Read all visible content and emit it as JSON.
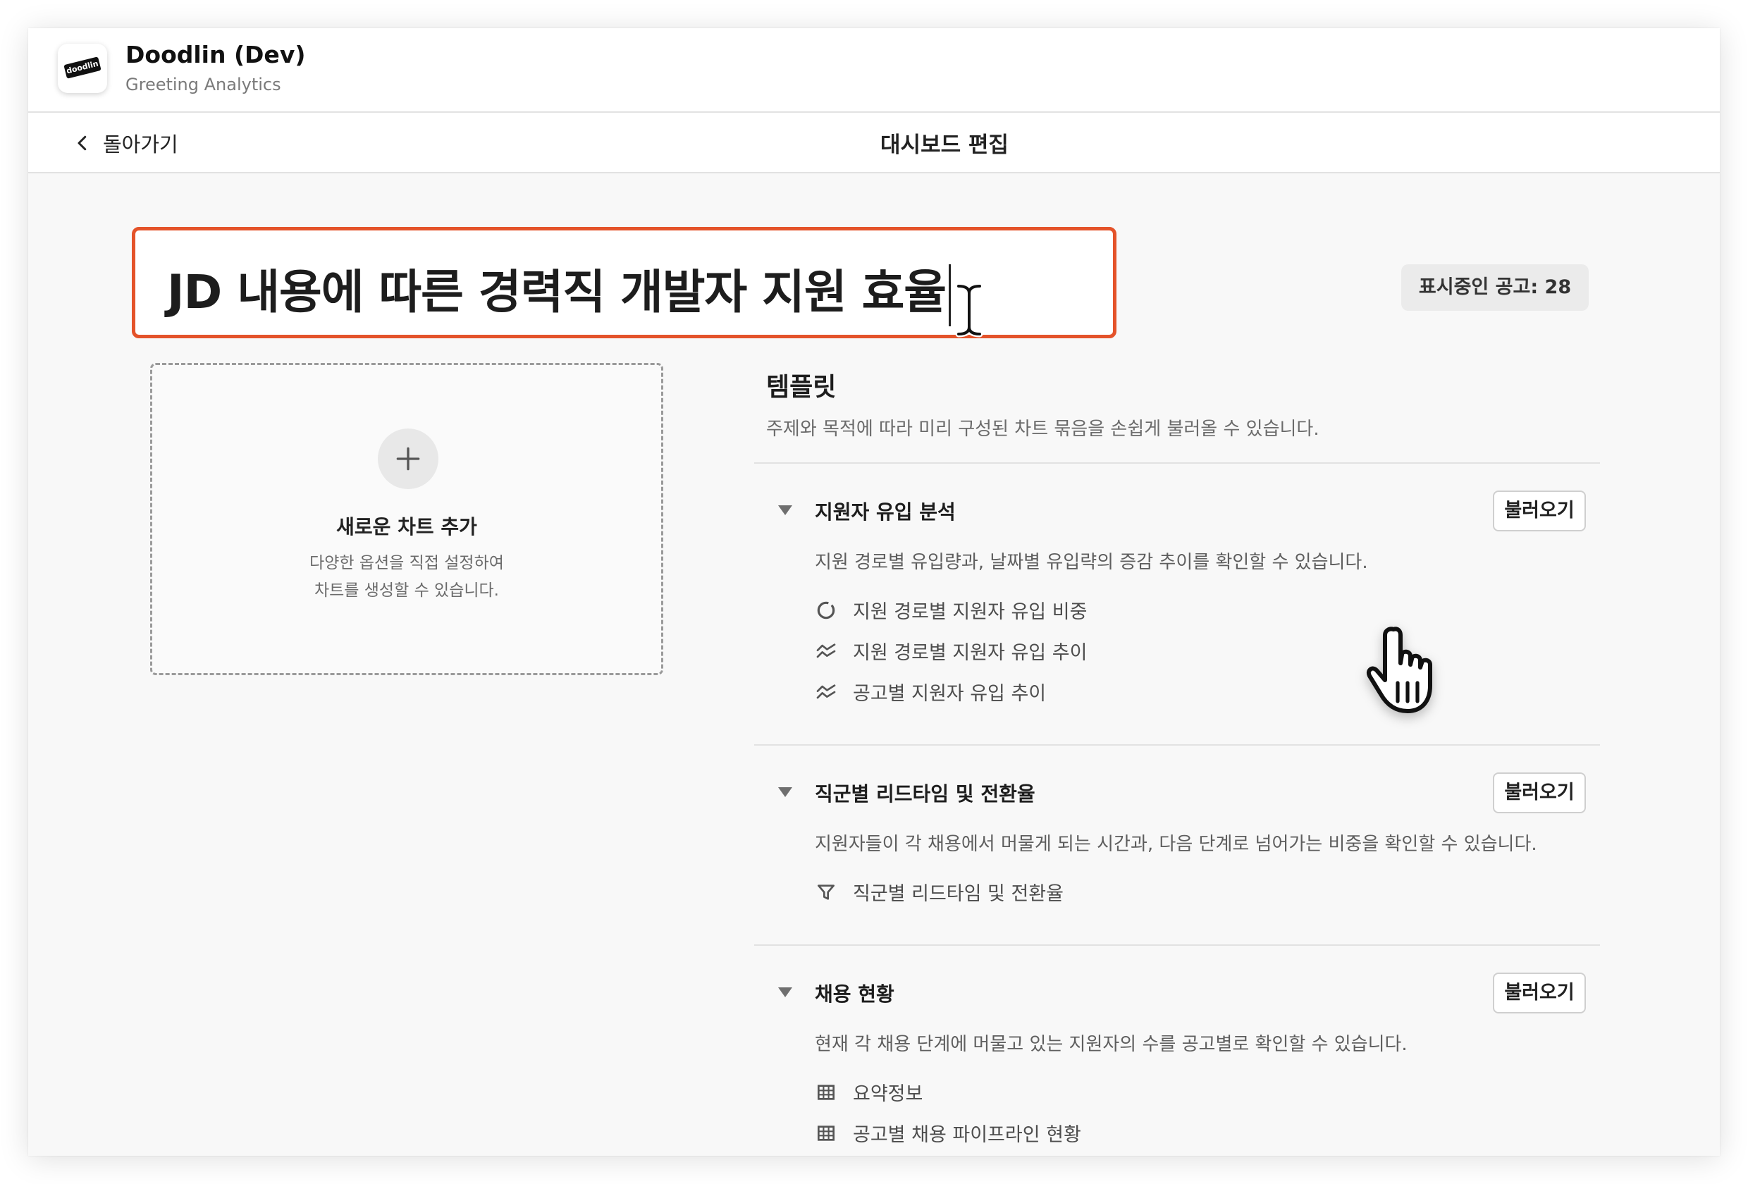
{
  "app": {
    "name": "Doodlin (Dev)",
    "subtitle": "Greeting Analytics",
    "logo_text": "doodlin"
  },
  "nav": {
    "back_label": "돌아가기",
    "page_title": "대시보드 편집"
  },
  "dashboard": {
    "title_value": "JD 내용에 따른 경력직 개발자 지원 효율",
    "badge_label": "표시중인 공고: 28"
  },
  "add_chart": {
    "title": "새로운 차트 추가",
    "desc_line1": "다양한 옵션을 직접 설정하여",
    "desc_line2": "차트를 생성할 수 있습니다."
  },
  "templates": {
    "heading": "템플릿",
    "description": "주제와 목적에 따라 미리 구성된 차트 묶음을 손쉽게 불러올 수 있습니다.",
    "load_label": "불러오기",
    "sections": [
      {
        "title": "지원자 유입 분석",
        "description": "지원 경로별 유입량과, 날짜별 유입략의 증감 추이를 확인할 수 있습니다.",
        "charts": [
          {
            "label": "지원 경로별 지원자 유입 비중",
            "icon": "donut-icon"
          },
          {
            "label": "지원 경로별 지원자 유입 추이",
            "icon": "line-chart-icon"
          },
          {
            "label": "공고별 지원자 유입 추이",
            "icon": "line-chart-icon"
          }
        ]
      },
      {
        "title": "직군별 리드타임 및 전환율",
        "description": "지원자들이 각 채용에서 머물게 되는 시간과, 다음 단계로 넘어가는 비중을 확인할 수 있습니다.",
        "charts": [
          {
            "label": "직군별 리드타임 및 전환율",
            "icon": "funnel-icon"
          }
        ]
      },
      {
        "title": "채용 현황",
        "description": "현재 각 채용 단계에 머물고 있는 지원자의 수를 공고별로 확인할 수 있습니다.",
        "charts": [
          {
            "label": "요약정보",
            "icon": "table-icon"
          },
          {
            "label": "공고별 채용 파이프라인 현황",
            "icon": "table-icon"
          }
        ]
      }
    ]
  },
  "colors": {
    "accent_border": "#e4532a",
    "background": "#f8f8f8",
    "badge_bg": "#ebebeb"
  }
}
